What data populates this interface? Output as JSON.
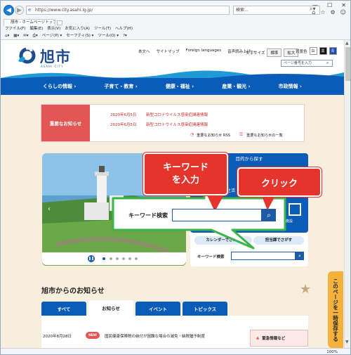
{
  "browser": {
    "tab_title": "旭市 - ホームページトップペ...",
    "address": "https://www.city.asahi.lg.jp/",
    "search_placeholder": "検索...",
    "menu": [
      "ファイル(F)",
      "編集(E)",
      "表示(V)",
      "お気に入り(A)",
      "ツール(T)",
      "ヘルプ(H)"
    ],
    "commands": [
      "ページ(P) ▾",
      "セーフティ(S) ▾",
      "ツール(O) ▾"
    ],
    "zoom": "100%"
  },
  "header": {
    "site_name": "旭市",
    "site_sub": "ASAHI CITY",
    "utility_links": [
      "本文へ",
      "サイトマップ",
      "Foreign languages",
      "音声読み上げ"
    ],
    "text_size_label": "文字サイズ",
    "text_size_standard": "標準",
    "text_size_large": "拡大",
    "bg_color_label": "背景色",
    "bg_white": "白",
    "bg_black": "黒",
    "bg_blue": "青",
    "page_number_placeholder": "ページ番号を入力"
  },
  "nav": [
    "くらしの情報 ›",
    "子育て・教育 ›",
    "健康・福祉 ›",
    "産業・観光 ›",
    "市政情報 ›"
  ],
  "notice": {
    "heading": "重要なお知らせ",
    "items": [
      {
        "date": "2020年6月5日",
        "text": "新型コロナウイルス感染症関連情報"
      },
      {
        "date": "2020年6月5日",
        "text": "新型コロナウイルス感染症関連情報"
      }
    ],
    "rss": "重要なお知らせ RSS",
    "list": "重要なお知らせの一覧"
  },
  "purpose": {
    "title": "目的から探す",
    "partial_label": "生活",
    "facility": "施設"
  },
  "search_panel": {
    "calendar_chip": "カレンダーでさがす",
    "section_chip": "担当課でさがす",
    "keyword_label": "キーワード検索"
  },
  "callouts": {
    "keyword_line1": "キーワード",
    "keyword_line2": "を入力",
    "click": "クリック",
    "zoom_label": "キーワード検索"
  },
  "news": {
    "title": "旭市からのお知らせ",
    "tabs": [
      "すべて",
      "お知らせ",
      "イベント",
      "トピックス"
    ],
    "active_tab": 1,
    "item": {
      "date": "2020年8月28日",
      "badge": "NEW",
      "text": "国民健康保険税の納付が困難な場合の減免・納税猶予制度"
    },
    "emergency": "緊急情報など"
  },
  "side_tab": "このページを一時保存する",
  "colors": {
    "primary_blue": "#0a5cb8",
    "notice_red": "#e25656",
    "callout_red": "#e5342c",
    "callout_green": "#3bb54a",
    "side_tab_orange": "#f4b23c"
  }
}
